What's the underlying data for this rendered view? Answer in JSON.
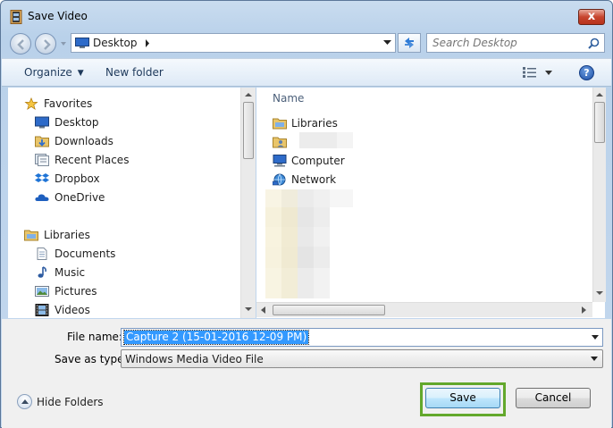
{
  "window": {
    "title": "Save Video",
    "close_glyph": "x"
  },
  "address": {
    "location": "Desktop",
    "search_placeholder": "Search Desktop"
  },
  "toolbar": {
    "organize_label": "Organize",
    "new_folder_label": "New folder"
  },
  "nav_tree": {
    "favorites": {
      "label": "Favorites",
      "items": [
        {
          "label": "Desktop",
          "icon": "desktop-icon"
        },
        {
          "label": "Downloads",
          "icon": "downloads-icon"
        },
        {
          "label": "Recent Places",
          "icon": "recent-places-icon"
        },
        {
          "label": "Dropbox",
          "icon": "dropbox-icon"
        },
        {
          "label": "OneDrive",
          "icon": "onedrive-icon"
        }
      ]
    },
    "libraries": {
      "label": "Libraries",
      "items": [
        {
          "label": "Documents",
          "icon": "documents-icon"
        },
        {
          "label": "Music",
          "icon": "music-icon"
        },
        {
          "label": "Pictures",
          "icon": "pictures-icon"
        },
        {
          "label": "Videos",
          "icon": "videos-icon"
        }
      ]
    }
  },
  "content": {
    "column_header": "Name",
    "items": [
      {
        "label": "Libraries",
        "icon": "libraries-icon"
      },
      {
        "label": "",
        "icon": "user-folder-icon"
      },
      {
        "label": "Computer",
        "icon": "computer-icon"
      },
      {
        "label": "Network",
        "icon": "network-icon"
      }
    ]
  },
  "form": {
    "file_name_label": "File name:",
    "file_name_value": "Capture 2 (15-01-2016 12-09 PM)",
    "save_type_label": "Save as type:",
    "save_type_value": "Windows Media Video File"
  },
  "footer": {
    "hide_folders_label": "Hide Folders",
    "save_label": "Save",
    "cancel_label": "Cancel"
  },
  "colors": {
    "highlight_outline": "#63a82c",
    "selection": "#3399ff",
    "close_button": "#c7452e"
  }
}
